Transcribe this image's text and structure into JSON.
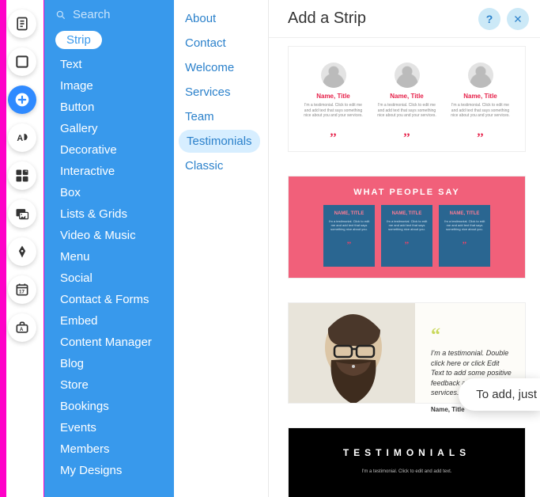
{
  "rail": {
    "items": [
      {
        "name": "pages-icon"
      },
      {
        "name": "background-icon"
      },
      {
        "name": "add-icon",
        "active": true
      },
      {
        "name": "theme-icon"
      },
      {
        "name": "apps-icon"
      },
      {
        "name": "media-icon"
      },
      {
        "name": "blog-icon"
      },
      {
        "name": "bookings-icon"
      },
      {
        "name": "ascend-icon"
      }
    ]
  },
  "search": {
    "placeholder": "Search"
  },
  "categories": {
    "selected": "Strip",
    "items": [
      "Text",
      "Image",
      "Button",
      "Gallery",
      "Decorative",
      "Interactive",
      "Box",
      "Lists & Grids",
      "Video & Music",
      "Menu",
      "Social",
      "Contact & Forms",
      "Embed",
      "Content Manager",
      "Blog",
      "Store",
      "Bookings",
      "Events",
      "Members",
      "My Designs"
    ]
  },
  "subcategories": {
    "items": [
      "About",
      "Contact",
      "Welcome",
      "Services",
      "Team",
      "Testimonials",
      "Classic"
    ],
    "active": "Testimonials"
  },
  "header": {
    "title": "Add a Strip"
  },
  "strip1": {
    "name": "Name, Title",
    "blurb": "I'm a testimonial. Click to edit me and add text that says something nice about you and your services."
  },
  "strip2": {
    "title": "WHAT PEOPLE SAY",
    "name": "NAME, TITLE",
    "blurb": "I'm a testimonial. Click to edit me and add text that says something nice about you."
  },
  "strip3": {
    "quote": "I'm a testimonial. Double click here or click Edit Text to add some positive feedback about your services.",
    "name": "Name, Title"
  },
  "strip4": {
    "title": "TESTIMONIALS",
    "sub": "I'm a testimonial. Click to edit and add text."
  },
  "tooltip": {
    "text": "To add, just"
  },
  "colors": {
    "accent": "#3899ec",
    "coral": "#f1607a",
    "red": "#e6214a"
  }
}
